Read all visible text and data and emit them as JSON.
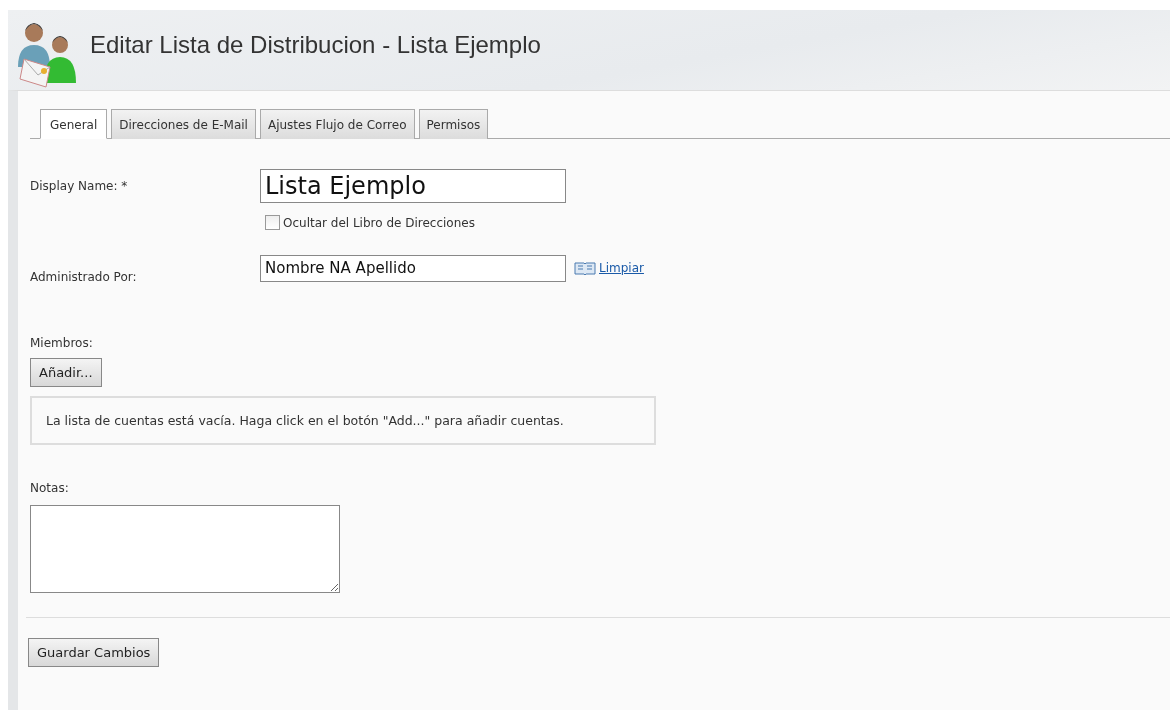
{
  "header": {
    "title": "Editar Lista de Distribucion - Lista Ejemplo"
  },
  "tabs": [
    {
      "label": "General",
      "selected": true
    },
    {
      "label": "Direcciones de E-Mail",
      "selected": false
    },
    {
      "label": "Ajustes Flujo de Correo",
      "selected": false
    },
    {
      "label": "Permisos",
      "selected": false
    }
  ],
  "display_name": {
    "label": "Display Name: *",
    "value": "Lista Ejemplo"
  },
  "hide_checkbox": {
    "label": "Ocultar del Libro de Direcciones",
    "checked": false
  },
  "managed_by": {
    "label": "Administrado Por:",
    "value": "Nombre NA Apellido",
    "link": "Limpiar"
  },
  "members": {
    "label": "Miembros:",
    "add_button": "Añadir...",
    "empty_message": "La lista de cuentas está vacía. Haga click en el botón \"Add...\" para añadir cuentas."
  },
  "notes": {
    "label": "Notas:"
  },
  "save_button": "Guardar Cambios"
}
